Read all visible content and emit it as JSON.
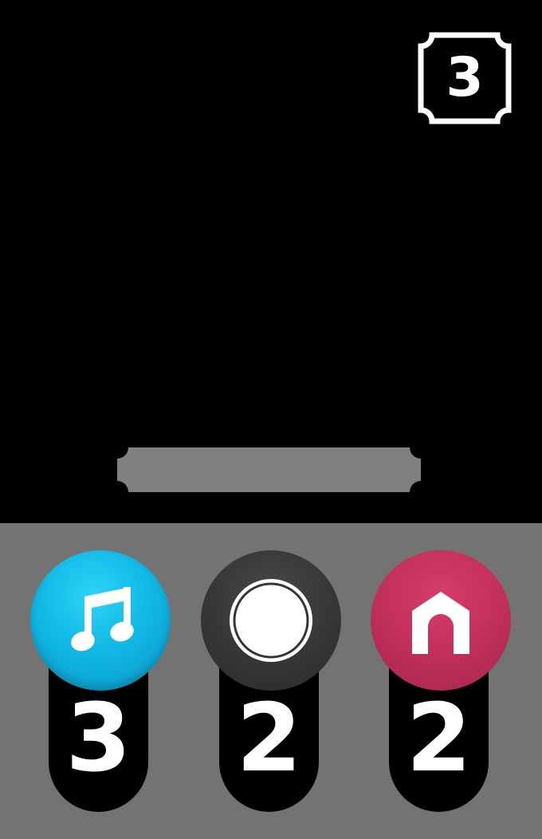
{
  "level": {
    "value": "3",
    "icon": "level-badge-frame"
  },
  "answer_bar": {
    "text": "",
    "color": "#808080"
  },
  "tray": {
    "background": "#737373",
    "slots": [
      {
        "icon": "music-note-icon",
        "color": "#12b8e6",
        "count": "3"
      },
      {
        "icon": "circle-icon",
        "color": "#363636",
        "count": "2"
      },
      {
        "icon": "home-icon",
        "color": "#c1305b",
        "count": "2"
      }
    ]
  }
}
